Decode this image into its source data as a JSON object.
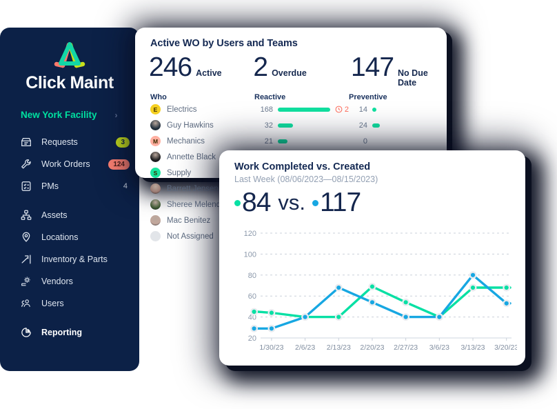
{
  "brand": {
    "name": "Click Maint",
    "logo_icon": "clickmaint-triangle-logo",
    "colors": {
      "navy": "#0C2147",
      "green": "#00E0A0",
      "blue": "#17A7E2",
      "lime": "#C7E01B",
      "coral": "#FF8172"
    }
  },
  "sidebar": {
    "facility": {
      "label": "New York Facility",
      "chevron": "›"
    },
    "items": [
      {
        "label": "Requests",
        "icon": "requests-inbox-icon",
        "badge": "3",
        "badge_style": "lime",
        "bold": false
      },
      {
        "label": "Work Orders",
        "icon": "wrench-icon",
        "badge": "124",
        "badge_style": "coral",
        "bold": false
      },
      {
        "label": "PMs",
        "icon": "checklist-icon",
        "badge": "4",
        "badge_style": "plain",
        "bold": false
      },
      {
        "label": "Assets",
        "icon": "assets-hierarchy-icon",
        "badge": "",
        "badge_style": "none",
        "bold": false
      },
      {
        "label": "Locations",
        "icon": "map-pin-icon",
        "badge": "",
        "badge_style": "none",
        "bold": false
      },
      {
        "label": "Inventory & Parts",
        "icon": "inventory-parts-icon",
        "badge": "",
        "badge_style": "none",
        "bold": false
      },
      {
        "label": "Vendors",
        "icon": "vendors-gear-icon",
        "badge": "",
        "badge_style": "none",
        "bold": false
      },
      {
        "label": "Users",
        "icon": "users-icon",
        "badge": "",
        "badge_style": "none",
        "bold": false
      },
      {
        "label": "Reporting",
        "icon": "pie-chart-icon",
        "badge": "",
        "badge_style": "none",
        "bold": true
      }
    ]
  },
  "wo_card": {
    "title": "Active WO by Users and Teams",
    "kpis": [
      {
        "value": "246",
        "label": "Active"
      },
      {
        "value": "2",
        "label": "Overdue"
      },
      {
        "value": "147",
        "label": "No Due Date"
      }
    ],
    "columns": {
      "who": "Who",
      "reactive": "Reactive",
      "preventive": "Preventive"
    },
    "rows": [
      {
        "name": "Electrics",
        "avatar_type": "initial",
        "initial": "E",
        "avatar_color": "#F5D021",
        "reactive": "168",
        "reactive_bar": 100,
        "overdue": "2",
        "overdue_icon": "clock-icon",
        "preventive": "14",
        "preventive_bar": 5
      },
      {
        "name": "Guy Hawkins",
        "avatar_type": "photo",
        "initial": "",
        "avatar_color": "#22313f",
        "reactive": "32",
        "reactive_bar": 19,
        "overdue": "",
        "overdue_icon": "",
        "preventive": "24",
        "preventive_bar": 9
      },
      {
        "name": "Mechanics",
        "avatar_type": "initial",
        "initial": "M",
        "avatar_color": "#FFAFA0",
        "reactive": "21",
        "reactive_bar": 12,
        "overdue": "",
        "overdue_icon": "",
        "preventive": "0",
        "preventive_bar": 0
      },
      {
        "name": "Annette Black",
        "avatar_type": "photo",
        "initial": "",
        "avatar_color": "#1d1d1f",
        "reactive": "",
        "reactive_bar": 0,
        "overdue": "",
        "overdue_icon": "",
        "preventive": "",
        "preventive_bar": 0
      },
      {
        "name": "Supply",
        "avatar_type": "initial",
        "initial": "S",
        "avatar_color": "#18E59E",
        "reactive": "",
        "reactive_bar": 0,
        "overdue": "",
        "overdue_icon": "",
        "preventive": "",
        "preventive_bar": 0
      },
      {
        "name": "Barrett Jensen",
        "avatar_type": "photo",
        "initial": "",
        "avatar_color": "#9b7a72",
        "reactive": "",
        "reactive_bar": 0,
        "overdue": "",
        "overdue_icon": "",
        "preventive": "",
        "preventive_bar": 0
      },
      {
        "name": "Sheree Melendez",
        "avatar_type": "photo",
        "initial": "",
        "avatar_color": "#3f5a34",
        "reactive": "",
        "reactive_bar": 0,
        "overdue": "",
        "overdue_icon": "",
        "preventive": "",
        "preventive_bar": 0
      },
      {
        "name": "Mac Benitez",
        "avatar_type": "photo",
        "initial": "",
        "avatar_color": "#c3a79c",
        "reactive": "",
        "reactive_bar": 0,
        "overdue": "",
        "overdue_icon": "",
        "preventive": "",
        "preventive_bar": 0
      },
      {
        "name": "Not Assigned",
        "avatar_type": "empty",
        "initial": "",
        "avatar_color": "#e2e5e9",
        "reactive": "",
        "reactive_bar": 0,
        "overdue": "",
        "overdue_icon": "",
        "preventive": "",
        "preventive_bar": 0
      }
    ]
  },
  "chart_card": {
    "title": "Work Completed vs. Created",
    "subtitle": "Last Week (08/06/2023—08/15/2023)",
    "summary": {
      "completed": "84",
      "separator": "vs.",
      "created": "117"
    }
  },
  "chart_data": {
    "type": "line",
    "title": "Work Completed vs. Created",
    "subtitle": "Last Week (08/06/2023—08/15/2023)",
    "categories": [
      "1/30/23",
      "2/6/23",
      "2/13/23",
      "2/20/23",
      "2/27/23",
      "3/6/23",
      "3/13/23",
      "3/20/23"
    ],
    "series": [
      {
        "name": "Completed",
        "color": "#07E0A4",
        "values": [
          44,
          40,
          40,
          69,
          54,
          40,
          68,
          68
        ],
        "lead_value": 45
      },
      {
        "name": "Created",
        "color": "#17A7E2",
        "values": [
          29,
          40,
          68,
          54,
          40,
          40,
          80,
          53
        ],
        "lead_value": 29
      }
    ],
    "ylim": [
      20,
      120
    ],
    "yticks": [
      20,
      40,
      60,
      80,
      100,
      120
    ],
    "ylabel": "",
    "xlabel": "",
    "grid": true,
    "legend": "none"
  }
}
